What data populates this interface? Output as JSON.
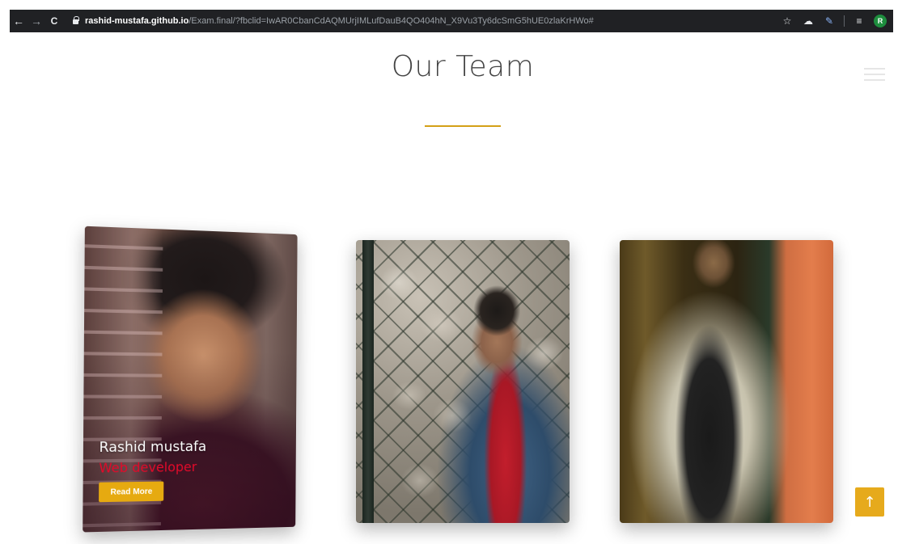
{
  "browser": {
    "back_icon": "←",
    "forward_icon": "→",
    "reload_icon": "C",
    "url_host": "rashid-mustafa.github.io",
    "url_path": "/Exam.final/?fbclid=IwAR0CbanCdAQMUrjIMLufDauB4QO404hN_X9Vu3Ty6dcSmG5hUE0zlaKrHWo#",
    "star_icon": "☆",
    "extension_icon": "☁",
    "pen_icon": "✎",
    "media_icon": "≡",
    "profile_initial": "R"
  },
  "page": {
    "title": "Our Team",
    "accent_color": "#d4a017"
  },
  "team": [
    {
      "name": "Rashid mustafa",
      "role": "Web developer",
      "button_label": "Read More"
    }
  ],
  "scroll_top_icon": "↑"
}
